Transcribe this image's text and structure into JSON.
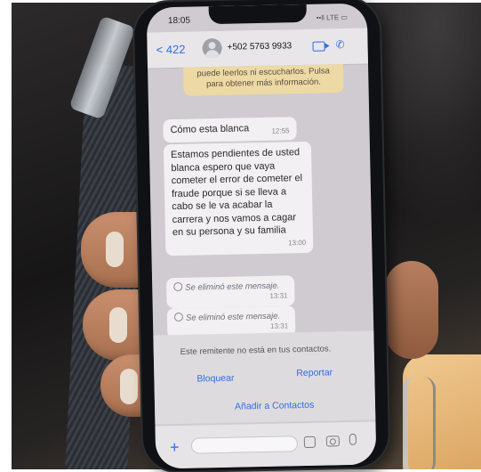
{
  "status_bar": {
    "time": "18:05",
    "icons": "••ll LTE ▭"
  },
  "header": {
    "back_label": "< 422",
    "phone_number": "+502 5763 9933"
  },
  "notice": {
    "text": "puede leerlos ni escucharlos. Pulsa para obtener más información."
  },
  "messages": [
    {
      "text": "Cómo esta blanca",
      "time": "12:55"
    },
    {
      "text": "Estamos pendientes de usted blanca espero que vaya cometer el error de cometer el fraude porque si se lleva a cabo se le va acabar la carrera y nos vamos a cagar en su persona y su familia",
      "time": "13:00"
    },
    {
      "text": "Se eliminó este mensaje.",
      "time": "13:31"
    },
    {
      "text": "Se eliminó este mensaje.",
      "time": "13:31"
    }
  ],
  "unknown_sender": {
    "text": "Este remitente no está en tus contactos.",
    "block_label": "Bloquear",
    "report_label": "Reportar",
    "add_label": "Añadir a Contactos"
  },
  "composer": {
    "plus_label": "+"
  }
}
